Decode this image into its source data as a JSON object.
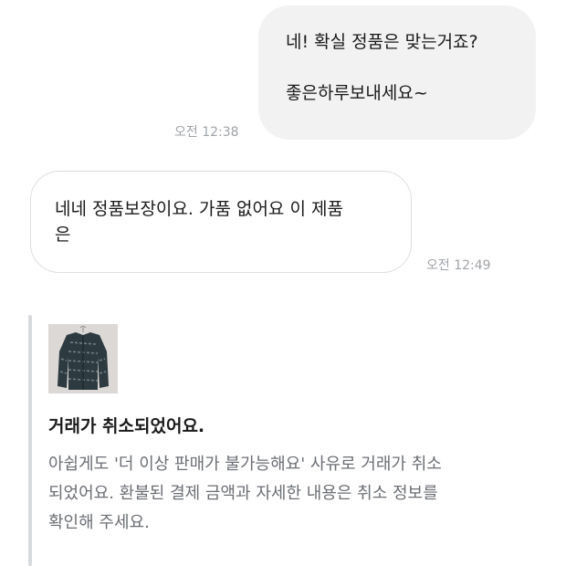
{
  "messages": {
    "mine": {
      "text": "네! 확실 정품은 맞는거죠?\n\n좋은하루보내세요~",
      "time": "오전 12:38"
    },
    "theirs": {
      "text": "네네 정품보장이요. 가품 없어요 이 제품\n은",
      "time": "오전 12:49"
    }
  },
  "notice": {
    "thumbnail_icon": "jacket-product-photo",
    "title": "거래가 취소되었어요.",
    "body": "아쉽게도 '더 이상 판매가 불가능해요' 사유로 거래가 취소되었어요. 환불된 결제 금액과 자세한 내용은 취소 정보를 확인해 주세요."
  },
  "colors": {
    "my_bubble_bg": "#f2f2f3",
    "their_bubble_border": "#dedfe2",
    "time_text": "#a0a3a8",
    "notice_body_text": "#6b6e73"
  }
}
